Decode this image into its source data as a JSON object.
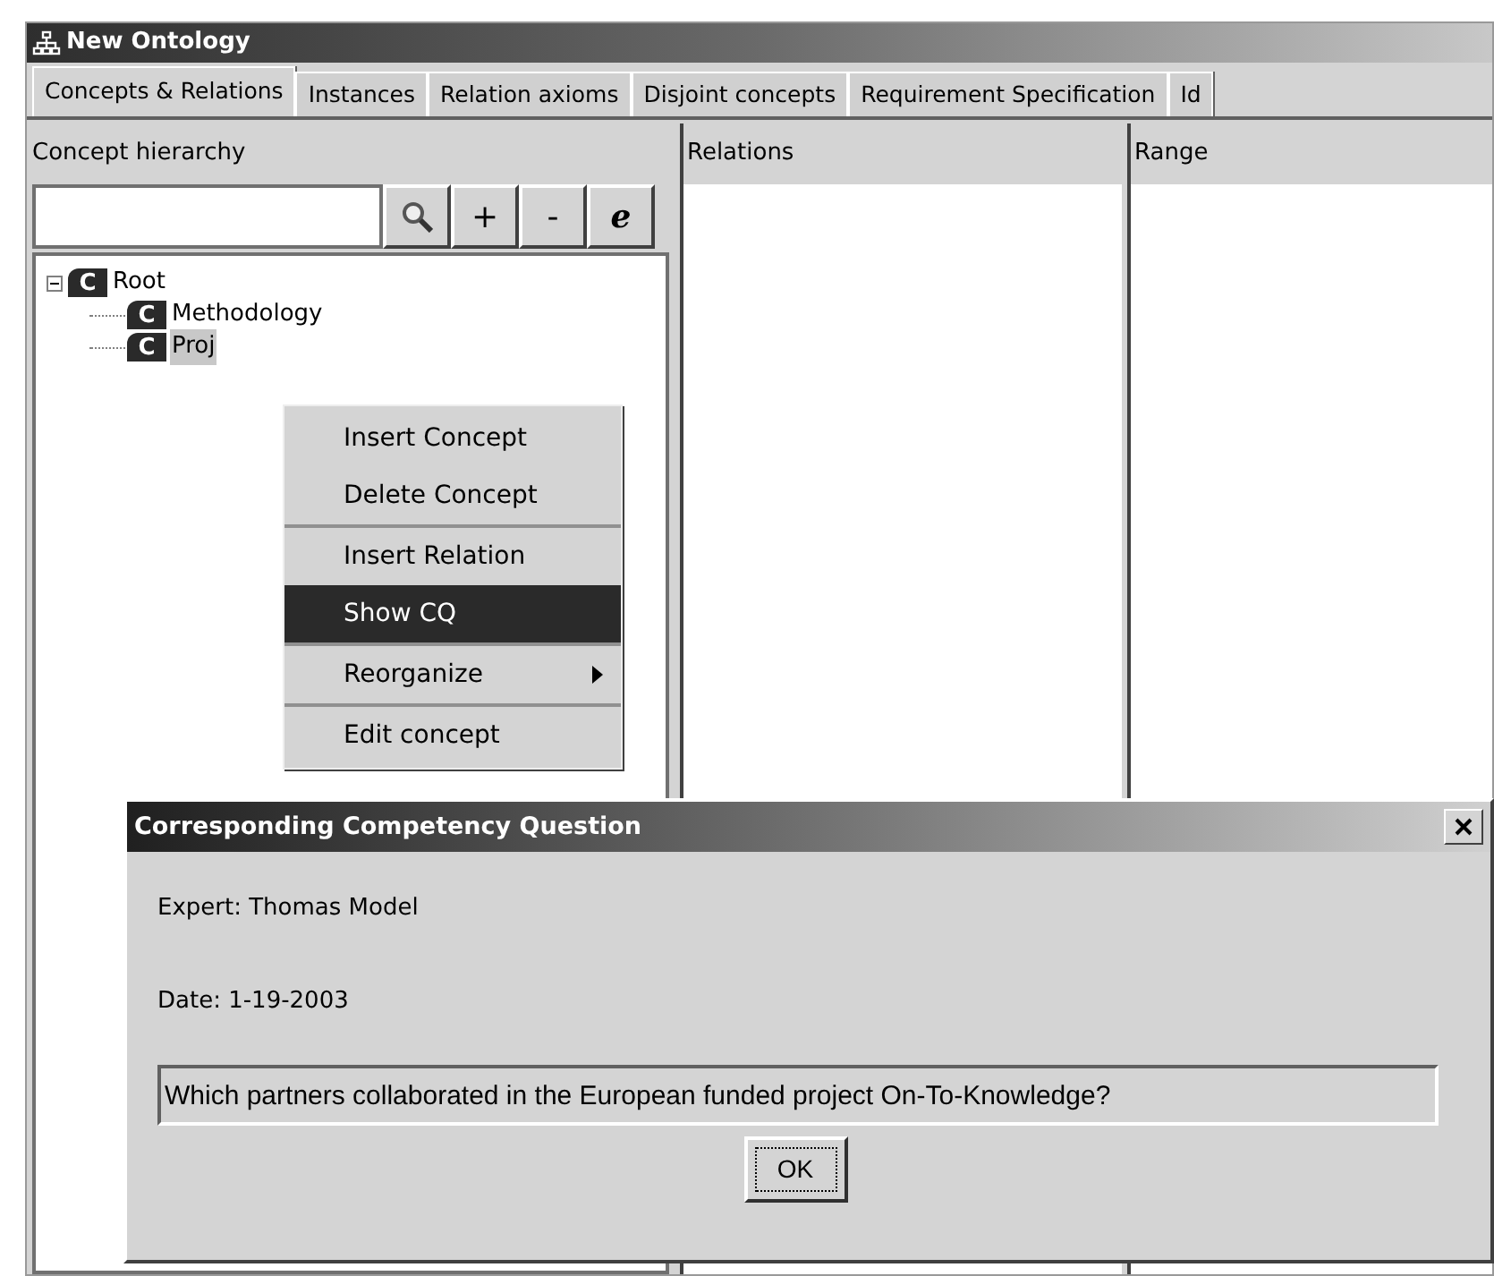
{
  "window": {
    "title": "New Ontology"
  },
  "tabs": [
    {
      "label": "Concepts & Relations",
      "selected": true
    },
    {
      "label": "Instances",
      "selected": false
    },
    {
      "label": "Relation axioms",
      "selected": false
    },
    {
      "label": "Disjoint concepts",
      "selected": false
    },
    {
      "label": "Requirement Specification",
      "selected": false
    },
    {
      "label": "Id",
      "selected": false
    }
  ],
  "concept_panel": {
    "title": "Concept hierarchy",
    "toolbar": [
      {
        "kind": "search"
      },
      {
        "kind": "text",
        "label": "+"
      },
      {
        "kind": "text",
        "label": "-"
      },
      {
        "kind": "italic",
        "label": "e"
      }
    ],
    "tree": [
      {
        "label": "Root",
        "badge": "C",
        "expanded": true,
        "selected": false,
        "children": [
          {
            "label": "Methodology",
            "badge": "C",
            "selected": false
          },
          {
            "label": "Proj",
            "badge": "C",
            "selected": true
          }
        ]
      }
    ]
  },
  "relations_panel": {
    "title": "Relations"
  },
  "range_panel": {
    "title": "Range"
  },
  "context_menu": {
    "groups": [
      [
        {
          "label": "Insert Concept",
          "selected": false,
          "submenu": false
        },
        {
          "label": "Delete Concept",
          "selected": false,
          "submenu": false
        }
      ],
      [
        {
          "label": "Insert Relation",
          "selected": false,
          "submenu": false
        },
        {
          "label": "Show CQ",
          "selected": true,
          "submenu": false
        }
      ],
      [
        {
          "label": "Reorganize",
          "selected": false,
          "submenu": true
        }
      ],
      [
        {
          "label": "Edit concept",
          "selected": false,
          "submenu": false
        }
      ]
    ]
  },
  "dialog": {
    "title": "Corresponding Competency Question",
    "expert": "Expert: Thomas Model",
    "date": "Date: 1-19-2003",
    "question": "Which partners collaborated in the European funded project On-To-Knowledge?",
    "button": "OK"
  }
}
